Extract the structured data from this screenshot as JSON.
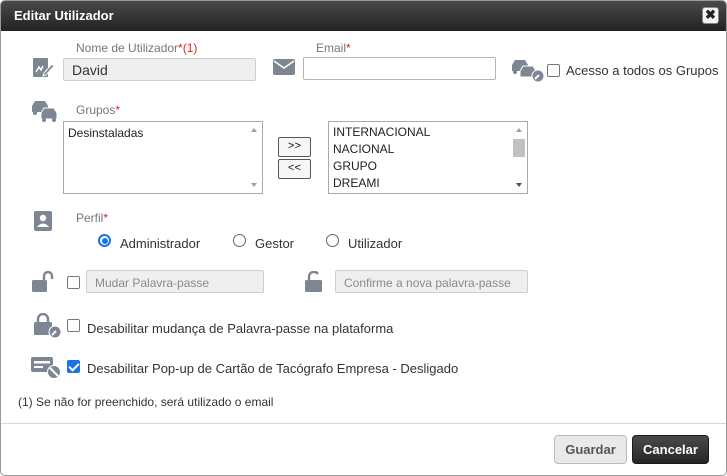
{
  "dialog": {
    "title": "Editar Utilizador",
    "close_symbol": "✖"
  },
  "form": {
    "username": {
      "label": "Nome de Utilizador",
      "label_suffix": "*(1)",
      "value": "David"
    },
    "email": {
      "label": "Email",
      "required_mark": "*",
      "value": "",
      "placeholder": ""
    },
    "all_groups": {
      "label": "Acesso a todos os Grupos",
      "checked": false
    },
    "groups": {
      "label": "Grupos",
      "required_mark": "*",
      "left_list": [
        "Desinstaladas"
      ],
      "right_list": [
        "INTERNACIONAL",
        "NACIONAL",
        "GRUPO",
        "DREAMI"
      ],
      "add_label": ">>",
      "remove_label": "<<"
    },
    "profile": {
      "label": "Perfil",
      "required_mark": "*",
      "options": [
        "Administrador",
        "Gestor",
        "Utilizador"
      ],
      "selected": "Administrador"
    },
    "change_password": {
      "checked": false,
      "placeholder": "Mudar Palavra-passe"
    },
    "confirm_password": {
      "placeholder": "Confirme a nova palavra-passe"
    },
    "disable_pw_change": {
      "label": "Desabilitar mudança de Palavra-passe na plataforma",
      "checked": false
    },
    "disable_popup": {
      "label": "Desabilitar Pop-up de Cartão de Tacógrafo Empresa - Desligado",
      "checked": true
    },
    "note": "(1) Se não for preenchido, será utilizado o email"
  },
  "buttons": {
    "save": "Guardar",
    "cancel": "Cancelar"
  },
  "colors": {
    "accent": "#1a73e8",
    "required": "#d9261c",
    "icon": "#7e8693"
  },
  "icons": [
    "user-edit-icon",
    "envelope-icon",
    "vehicles-key-icon",
    "vehicles-icon",
    "profile-card-icon",
    "unlock-icon",
    "unlock-icon",
    "lock-key-icon",
    "tachograph-card-icon"
  ]
}
